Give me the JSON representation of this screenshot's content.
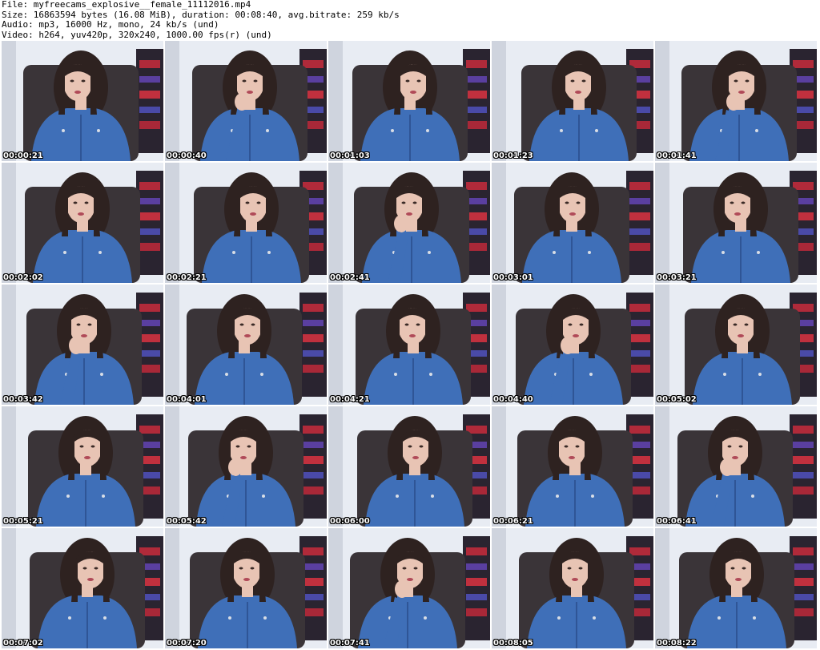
{
  "header": {
    "file": "File: myfreecams_explosive__female_11112016.mp4",
    "size": "Size: 16863594 bytes (16.08 MiB), duration: 00:08:40, avg.bitrate: 259 kb/s",
    "audio": "Audio: mp3, 16000 Hz, mono, 24 kb/s (und)",
    "video": "Video: h264, yuv420p, 320x240, 1000.00 fps(r) (und)"
  },
  "thumbnails": [
    {
      "timestamp": "00:00:21"
    },
    {
      "timestamp": "00:00:40"
    },
    {
      "timestamp": "00:01:03"
    },
    {
      "timestamp": "00:01:23"
    },
    {
      "timestamp": "00:01:41"
    },
    {
      "timestamp": "00:02:02"
    },
    {
      "timestamp": "00:02:21"
    },
    {
      "timestamp": "00:02:41"
    },
    {
      "timestamp": "00:03:01"
    },
    {
      "timestamp": "00:03:21"
    },
    {
      "timestamp": "00:03:42"
    },
    {
      "timestamp": "00:04:01"
    },
    {
      "timestamp": "00:04:21"
    },
    {
      "timestamp": "00:04:40"
    },
    {
      "timestamp": "00:05:02"
    },
    {
      "timestamp": "00:05:21"
    },
    {
      "timestamp": "00:05:42"
    },
    {
      "timestamp": "00:06:00"
    },
    {
      "timestamp": "00:06:21"
    },
    {
      "timestamp": "00:06:41"
    },
    {
      "timestamp": "00:07:02"
    },
    {
      "timestamp": "00:07:20"
    },
    {
      "timestamp": "00:07:41"
    },
    {
      "timestamp": "00:08:05"
    },
    {
      "timestamp": "00:08:22"
    }
  ],
  "colors": {
    "background": "#ffffff",
    "wall": "#e8ecf3",
    "chair": "#3a3438",
    "jacket": "#3f6fb8",
    "hair": "#2e2220",
    "skin": "#e8c4b4",
    "timestamp_text": "#ffffff"
  }
}
